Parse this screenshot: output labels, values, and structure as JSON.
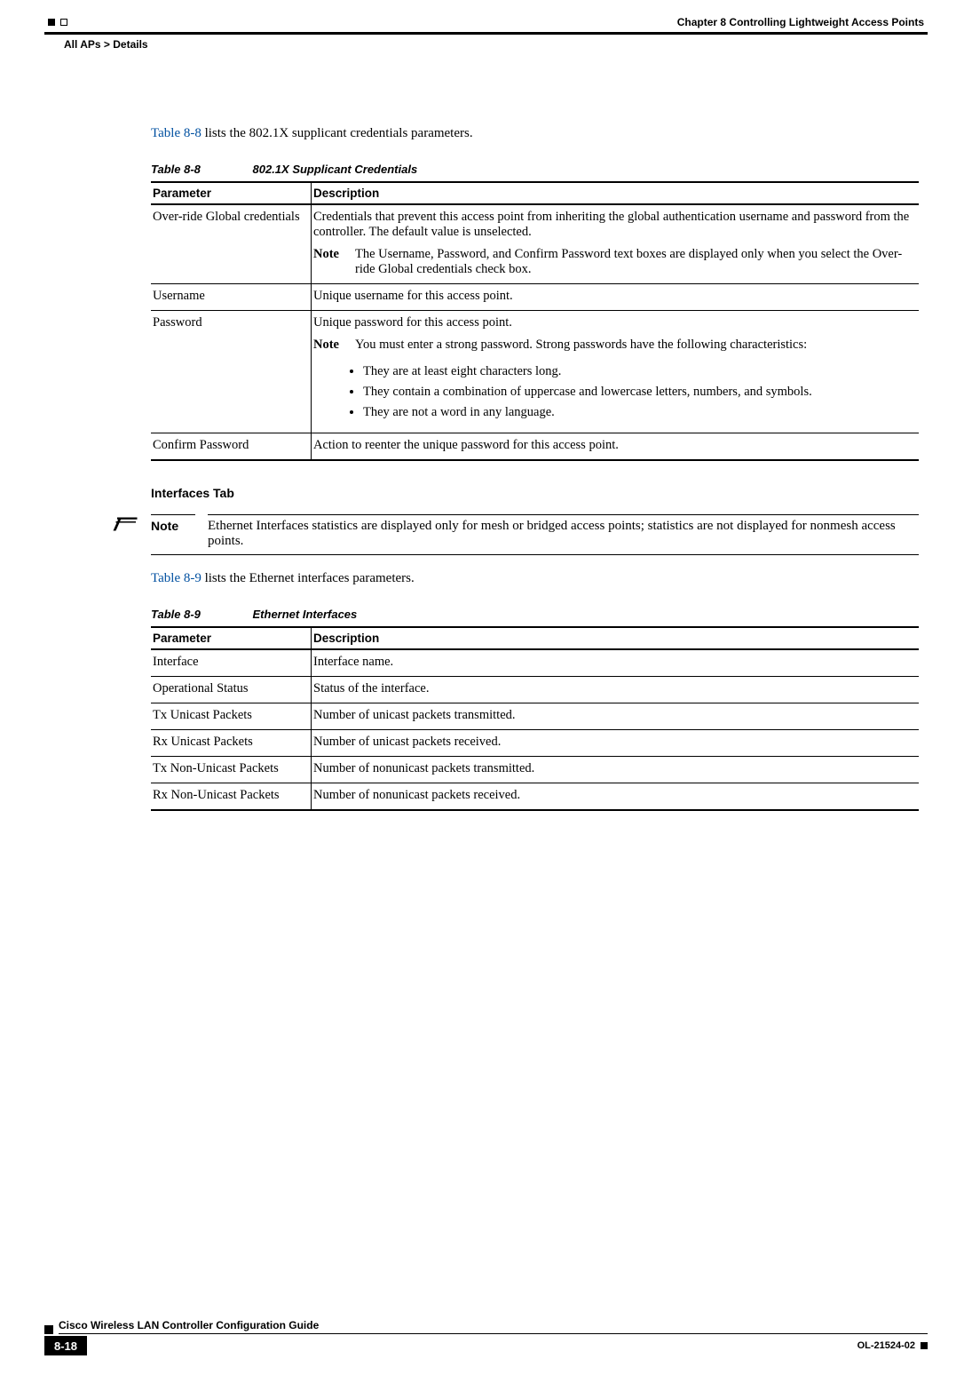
{
  "header": {
    "chapter": "Chapter 8      Controlling Lightweight Access Points",
    "breadcrumb": "All APs > Details"
  },
  "intro1_pre": "Table 8-8",
  "intro1_post": " lists the 802.1X supplicant credentials parameters.",
  "table8_8": {
    "label": "Table 8-8",
    "title": "802.1X Supplicant Credentials",
    "col_param": "Parameter",
    "col_desc": "Description",
    "rows": {
      "r0p": "Over-ride Global credentials",
      "r0d": "Credentials that prevent this access point from inheriting the global authentication username and password from the controller. The default value is unselected.",
      "r0note_label": "Note",
      "r0note": "The Username, Password, and Confirm Password text boxes are displayed only when you select the Over-ride Global credentials check box.",
      "r1p": "Username",
      "r1d": "Unique username for this access point.",
      "r2p": "Password",
      "r2d": "Unique password for this access point.",
      "r2note_label": "Note",
      "r2note": "You must enter a strong password. Strong passwords have the following characteristics:",
      "r2b1": "They are at least eight characters long.",
      "r2b2": "They contain a combination of uppercase and lowercase letters, numbers, and symbols.",
      "r2b3": "They are not a word in any language.",
      "r3p": "Confirm Password",
      "r3d": "Action to reenter the unique password for this access point."
    }
  },
  "section_interfaces": "Interfaces Tab",
  "note_label": "Note",
  "note_text": "Ethernet Interfaces statistics are displayed only for mesh or bridged access points; statistics are not displayed for nonmesh access points.",
  "intro2_pre": "Table 8-9",
  "intro2_post": " lists the Ethernet interfaces parameters.",
  "table8_9": {
    "label": "Table 8-9",
    "title": "Ethernet Interfaces",
    "col_param": "Parameter",
    "col_desc": "Description",
    "rows": {
      "r0p": "Interface",
      "r0d": "Interface name.",
      "r1p": "Operational Status",
      "r1d": "Status of the interface.",
      "r2p": "Tx Unicast Packets",
      "r2d": "Number of unicast packets transmitted.",
      "r3p": "Rx Unicast Packets",
      "r3d": "Number of unicast packets received.",
      "r4p": "Tx Non-Unicast Packets",
      "r4d": "Number of nonunicast packets transmitted.",
      "r5p": "Rx Non-Unicast Packets",
      "r5d": "Number of nonunicast packets received."
    }
  },
  "footer": {
    "page": "8-18",
    "guide": "Cisco Wireless LAN Controller Configuration Guide",
    "doc": "OL-21524-02"
  }
}
